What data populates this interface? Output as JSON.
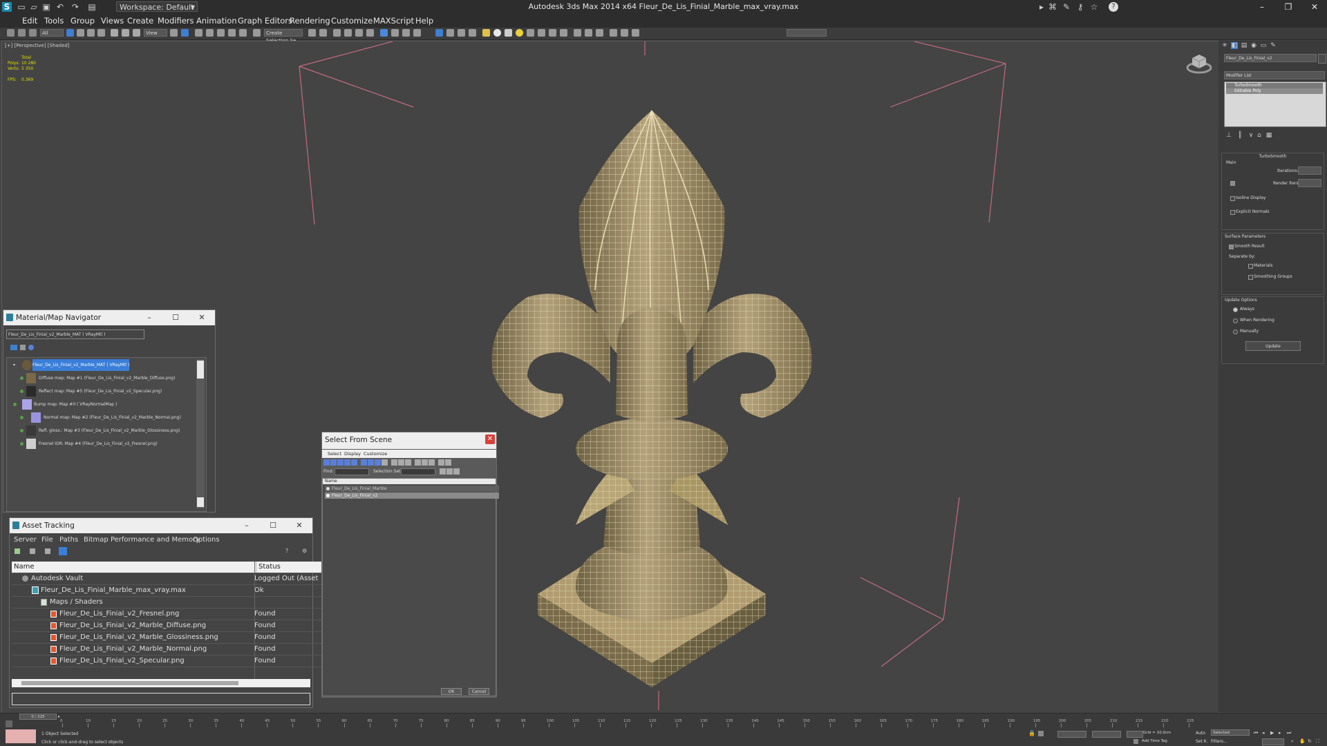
{
  "window": {
    "title": "Autodesk 3ds Max  2014 x64     Fleur_De_Lis_Finial_Marble_max_vray.max",
    "workspace_label": "Workspace: Default"
  },
  "menu": [
    "Edit",
    "Tools",
    "Group",
    "Views",
    "Create",
    "Modifiers",
    "Animation",
    "Graph Editors",
    "Rendering",
    "Customize",
    "MAXScript",
    "Help"
  ],
  "toolbar": {
    "selection_filter": "All",
    "view_dropdown": "View",
    "named_selection": "Create Selection Se"
  },
  "viewport": {
    "label": "[+] [Perspective] [Shaded]",
    "stats": {
      "total_label": "Total",
      "polys_label": "Polys:",
      "polys_value": "10 280",
      "verts_label": "Verts:",
      "verts_value": "5 350",
      "fps_label": "FPS:",
      "fps_value": "0.369"
    },
    "colors": {
      "background": "#444444",
      "model": "#9a8a62",
      "wire": "#f0e8c8",
      "grid": "#c06a80"
    }
  },
  "command_panel": {
    "object_name": "Fleur_De_Lis_Finial_v2",
    "modifier_list_label": "Modifier List",
    "stack": [
      "TurboSmooth",
      "Editable Poly"
    ],
    "turbosmooth": {
      "title": "TurboSmooth",
      "main_label": "Main",
      "iterations_label": "Iterations:",
      "render_iters_label": "Render Iters:",
      "isoline_display": "Isoline Display",
      "explicit_normals": "Explicit Normals"
    },
    "surface_parameters": {
      "title": "Surface Parameters",
      "smooth_result": "Smooth Result",
      "separate_by": "Separate by:",
      "materials": "Materials",
      "smoothing_groups": "Smoothing Groups"
    },
    "update_options": {
      "title": "Update Options",
      "always": "Always",
      "when_rendering": "When Rendering",
      "manually": "Manually",
      "update_button": "Update"
    }
  },
  "material_navigator": {
    "title": "Material/Map Navigator",
    "current": "Fleur_De_Lis_Finial_v2_Marble_MAT  ( VRayMtl )",
    "tree": [
      {
        "label": "Fleur_De_Lis_Finial_v2_Marble_MAT  ( VRayMtl )",
        "thumb": "#6b5a3a",
        "selected": true
      },
      {
        "label": "Diffuse map: Map #1 (Fleur_De_Lis_Finial_v2_Marble_Diffuse.png)",
        "thumb": "#7a6a48"
      },
      {
        "label": "Reflect map: Map #5 (Fleur_De_Lis_Finial_v2_Specular.png)",
        "thumb": "#2a2a2a"
      },
      {
        "label": "Bump map: Map #0  ( VRayNormalMap )",
        "thumb": "#a9a4e8"
      },
      {
        "label": "Normal map: Map #2 (Fleur_De_Lis_Finial_v2_Marble_Normal.png)",
        "thumb": "#9a94e0"
      },
      {
        "label": "Refl. gloss.: Map #3 (Fleur_De_Lis_Finial_v2_Marble_Glossiness.png)",
        "thumb": "#3a3a3a"
      },
      {
        "label": "Fresnel IOR: Map #4 (Fleur_De_Lis_Finial_v2_Fresnel.png)",
        "thumb": "#cfcfcf"
      }
    ]
  },
  "asset_tracking": {
    "title": "Asset Tracking",
    "menu": [
      "Server",
      "File",
      "Paths",
      "Bitmap Performance and Memory",
      "Options"
    ],
    "columns": {
      "name": "Name",
      "status": "Status"
    },
    "rows": [
      {
        "name": "Autodesk Vault",
        "status": "Logged Out (Asset"
      },
      {
        "name": "Fleur_De_Lis_Finial_Marble_max_vray.max",
        "status": "Ok"
      },
      {
        "name": "Maps / Shaders",
        "status": ""
      },
      {
        "name": "Fleur_De_Lis_Finial_v2_Fresnel.png",
        "status": "Found"
      },
      {
        "name": "Fleur_De_Lis_Finial_v2_Marble_Diffuse.png",
        "status": "Found"
      },
      {
        "name": "Fleur_De_Lis_Finial_v2_Marble_Glossiness.png",
        "status": "Found"
      },
      {
        "name": "Fleur_De_Lis_Finial_v2_Marble_Normal.png",
        "status": "Found"
      },
      {
        "name": "Fleur_De_Lis_Finial_v2_Specular.png",
        "status": "Found"
      }
    ]
  },
  "select_from_scene": {
    "title": "Select From Scene",
    "menu": [
      "Select",
      "Display",
      "Customize"
    ],
    "find_label": "Find:",
    "selection_set_label": "Selection Set:",
    "column_name": "Name",
    "items": [
      "Fleur_De_Lis_Finial_Marble",
      "Fleur_De_Lis_Finial_v2"
    ],
    "ok": "OK",
    "cancel": "Cancel"
  },
  "timeline": {
    "frame_label": "0 / 225",
    "ticks": [
      "0",
      "10",
      "15",
      "20",
      "25",
      "30",
      "35",
      "40",
      "45",
      "50",
      "55",
      "60",
      "65",
      "70",
      "75",
      "80",
      "85",
      "90",
      "95",
      "100",
      "105",
      "110",
      "115",
      "120",
      "125",
      "130",
      "135",
      "140",
      "145",
      "150",
      "155",
      "160",
      "165",
      "170",
      "175",
      "180",
      "185",
      "190",
      "195",
      "200",
      "205",
      "210",
      "215",
      "220",
      "225"
    ]
  },
  "status": {
    "objects_selected": "1 Object Selected",
    "prompt": "Click or click-and-drag to select objects",
    "grid": "Grid = 10,0cm",
    "add_time_tag": "Add Time Tag",
    "auto": "Auto",
    "selected": "Selected",
    "set_k": "Set K.",
    "filters": "Filters..."
  }
}
